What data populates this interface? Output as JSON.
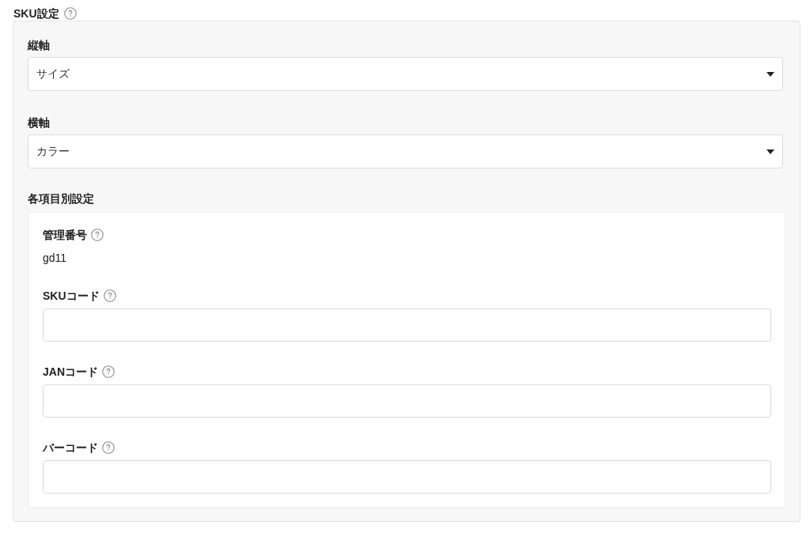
{
  "section": {
    "title": "SKU設定",
    "help": true
  },
  "axes": [
    {
      "label": "縦軸",
      "value": "サイズ"
    },
    {
      "label": "横軸",
      "value": "カラー"
    }
  ],
  "item_settings": {
    "title": "各項目別設定",
    "fields": [
      {
        "kind": "text",
        "label": "管理番号",
        "help": true,
        "value": "gd11"
      },
      {
        "kind": "input",
        "label": "SKUコード",
        "help": true
      },
      {
        "kind": "input",
        "label": "JANコード",
        "help": true
      },
      {
        "kind": "input",
        "label": "バーコード",
        "help": true
      }
    ]
  }
}
